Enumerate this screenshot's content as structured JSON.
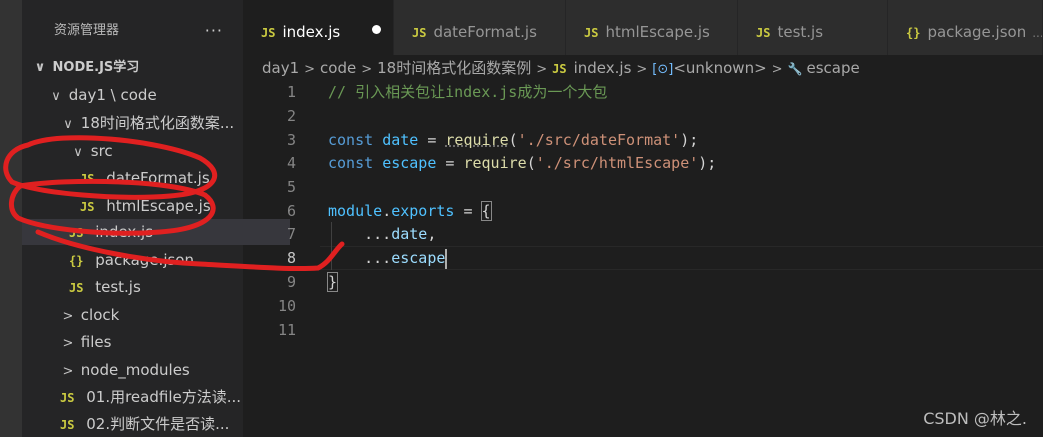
{
  "sidebar": {
    "title": "资源管理器",
    "more_label": "···",
    "root_label": "NODE.JS学习",
    "items": [
      {
        "label": "day1 \\ code",
        "chevron": "∨"
      },
      {
        "label": "18时间格式化函数案...",
        "chevron": "∨"
      },
      {
        "label": "src",
        "chevron": "∨"
      },
      {
        "label": "dateFormat.js",
        "badge": "JS"
      },
      {
        "label": "htmlEscape.js",
        "badge": "JS"
      },
      {
        "label": "index.js",
        "badge": "JS"
      },
      {
        "label": "package.json",
        "badge": "{}"
      },
      {
        "label": "test.js",
        "badge": "JS"
      },
      {
        "label": "clock",
        "chevron": ">"
      },
      {
        "label": "files",
        "chevron": ">"
      },
      {
        "label": "node_modules",
        "chevron": ">"
      },
      {
        "label": "01.用readfile方法读...",
        "badge": "JS"
      },
      {
        "label": "02.判断文件是否读...",
        "badge": "JS"
      }
    ]
  },
  "tabs": [
    {
      "label": "index.js",
      "badge": "JS"
    },
    {
      "label": "dateFormat.js",
      "badge": "JS"
    },
    {
      "label": "htmlEscape.js",
      "badge": "JS"
    },
    {
      "label": "test.js",
      "badge": "JS"
    },
    {
      "label": "package.json",
      "badge": "{}",
      "extra": "...\\"
    }
  ],
  "breadcrumb": {
    "parts": [
      "day1",
      "code",
      "18时间格式化函数案例",
      "index.js",
      "<unknown>",
      "escape"
    ],
    "js_badge": "JS",
    "unknown_icon": "[⊙]",
    "wrench_icon": "🔧"
  },
  "editor": {
    "line_numbers": [
      "1",
      "2",
      "3",
      "4",
      "5",
      "6",
      "7",
      "8",
      "9",
      "10",
      "11"
    ],
    "current_line": "8",
    "lines": {
      "l1_comment": "// 引入相关包让index.js成为一个大包",
      "l3_const": "const",
      "l3_name": "date",
      "l3_eq": " = ",
      "l3_fn": "require",
      "l3_open": "(",
      "l3_str": "'./src/dateFormat'",
      "l3_close": ");",
      "l4_const": "const",
      "l4_name": "escape",
      "l4_eq": " = ",
      "l4_fn": "require",
      "l4_open": "(",
      "l4_str": "'./src/htmlEscape'",
      "l4_close": ");",
      "l6_module": "module",
      "l6_dot": ".",
      "l6_exports": "exports",
      "l6_eq": " = ",
      "l6_brace": "{",
      "l7_spread": "...",
      "l7_name": "date",
      "l7_comma": ",",
      "l8_spread": "...",
      "l8_name": "escape",
      "l9_brace": "}"
    }
  },
  "watermark": "CSDN @林之.",
  "colors": {
    "editor_bg": "#1e1e1e",
    "sidebar_bg": "#252526",
    "js_badge": "#cbcb41",
    "annotation": "#e02020"
  }
}
